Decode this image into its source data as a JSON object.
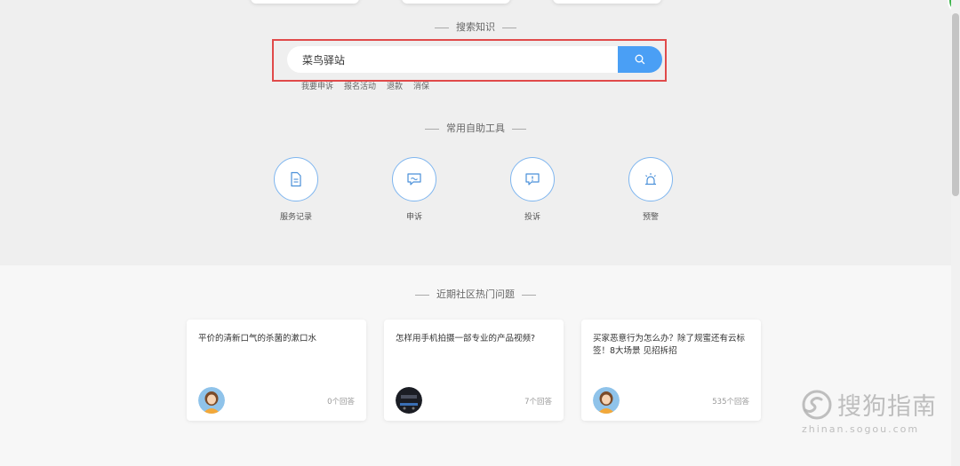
{
  "search_section": {
    "title": "搜索知识",
    "input_value": "菜鸟驿站",
    "quick_links": [
      "我要申诉",
      "报名活动",
      "退款",
      "消保"
    ]
  },
  "tools_section": {
    "title": "常用自助工具",
    "tools": [
      {
        "label": "服务记录",
        "icon": "document-icon"
      },
      {
        "label": "申诉",
        "icon": "chat-icon"
      },
      {
        "label": "投诉",
        "icon": "alert-message-icon"
      },
      {
        "label": "预警",
        "icon": "alarm-light-icon"
      }
    ]
  },
  "community_section": {
    "title": "近期社区热门问题",
    "cards": [
      {
        "title": "平价的清新口气的杀菌的漱口水",
        "count": "0个回答"
      },
      {
        "title": "怎样用手机拍摄一部专业的产品视频?",
        "count": "7个回答"
      },
      {
        "title": "买家恶意行为怎么办？除了规蜜还有云标签！8大场景 见招拆招",
        "count": "535个回答"
      }
    ]
  },
  "watermark": {
    "text": "搜狗指南",
    "url": "zhinan.sogou.com"
  },
  "colors": {
    "accent": "#4a9ff5",
    "highlight_border": "#e04a4a",
    "icon_stroke": "#4a90d9"
  }
}
